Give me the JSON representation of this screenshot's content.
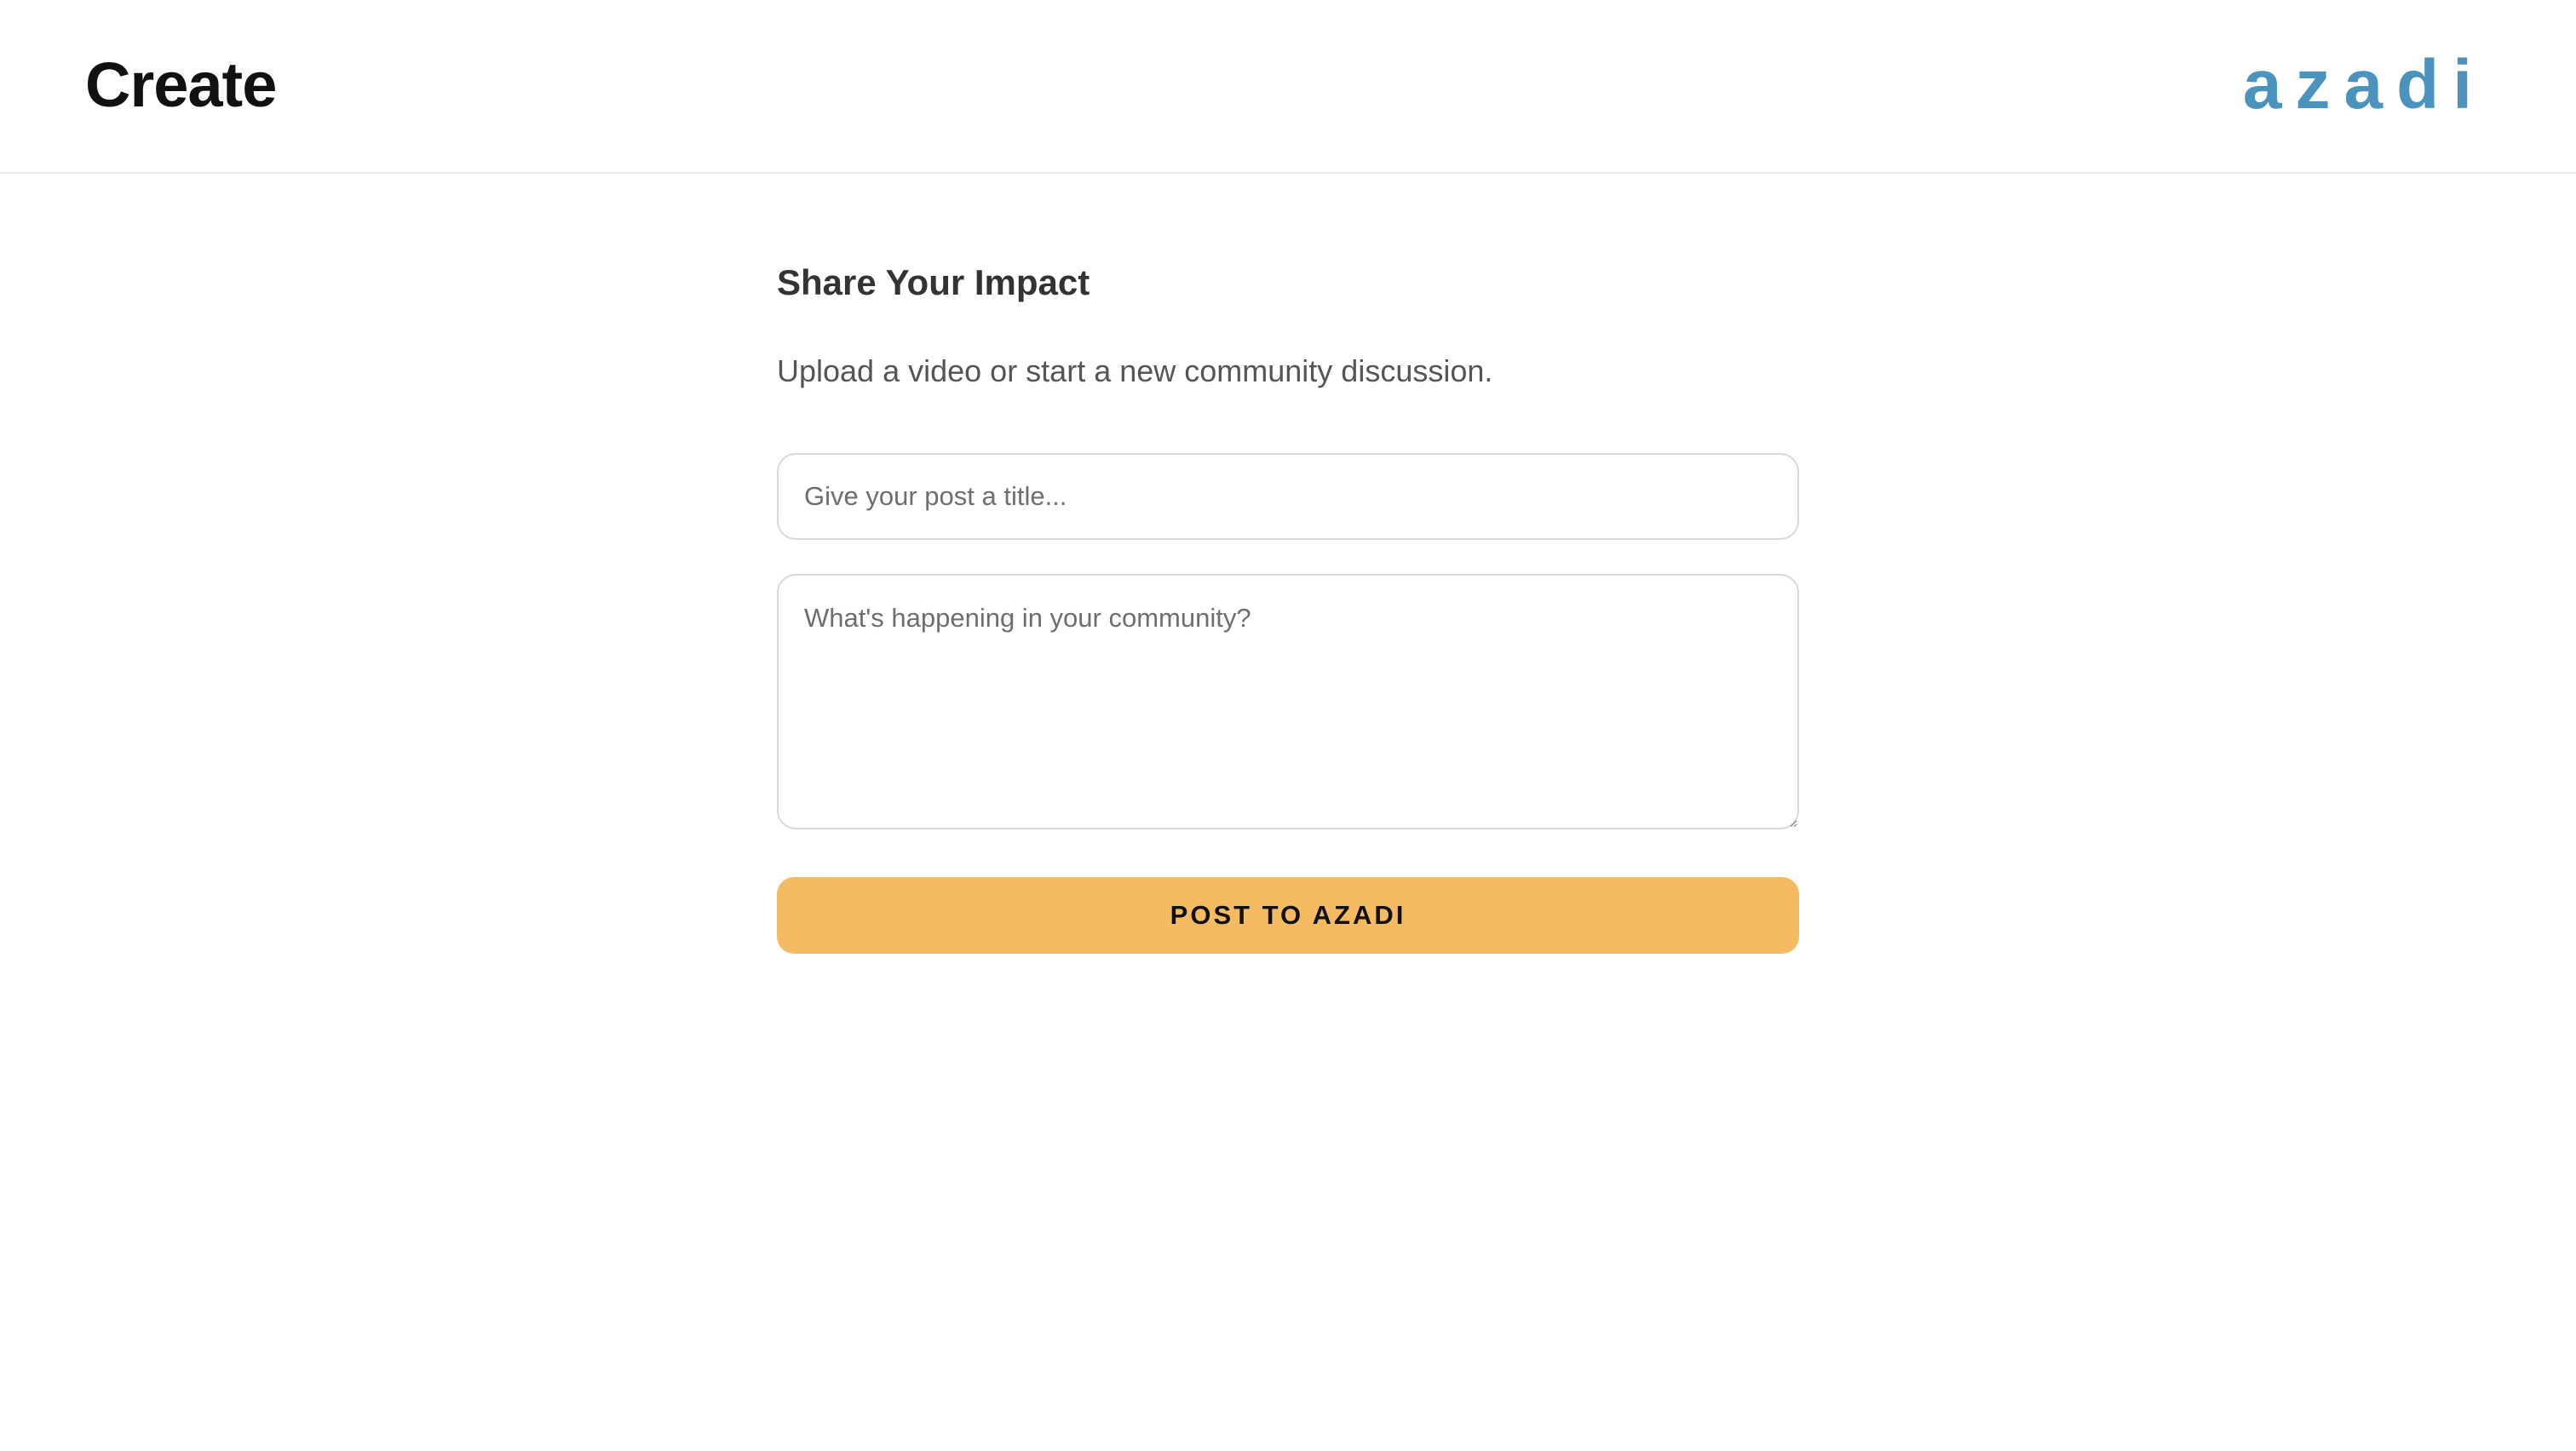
{
  "header": {
    "title": "Create",
    "logo_text": "azadi",
    "logo_color": "#4b93bd"
  },
  "form": {
    "heading": "Share Your Impact",
    "subtitle": "Upload a video or start a new community discussion.",
    "title_placeholder": "Give your post a title...",
    "title_value": "",
    "body_placeholder": "What's happening in your community?",
    "body_value": "",
    "submit_label": "POST TO AZADI",
    "submit_color": "#f4bb63"
  }
}
